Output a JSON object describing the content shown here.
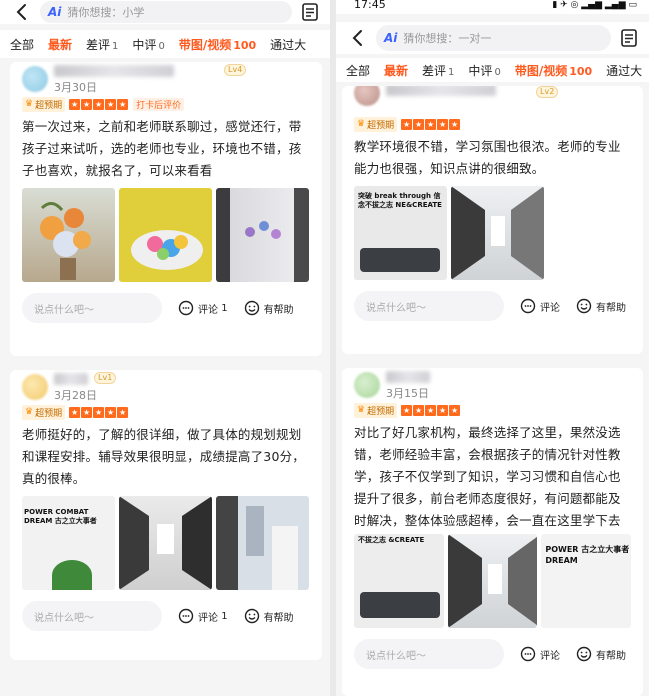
{
  "left": {
    "search_placeholder": "猜你想搜：小学",
    "ai_label": "Ai",
    "tabs": [
      {
        "label": "全部",
        "count": ""
      },
      {
        "label": "最新",
        "count": ""
      },
      {
        "label": "差评",
        "count": "1"
      },
      {
        "label": "中评",
        "count": "0"
      },
      {
        "label": "带图/视频",
        "count": "100"
      },
      {
        "label": "通过大",
        "count": ""
      }
    ],
    "reviews": [
      {
        "level": "Lv4",
        "date": "3月30日",
        "badge": "超预期",
        "clock_tag": "打卡后评价",
        "text": "第一次过来，之前和老师联系聊过，感觉还行，带孩子过来试听，选的老师也专业，环境也不错，孩子也喜欢，就报名了，可以来看看",
        "comment_placeholder": "说点什么吧～",
        "comment_label": "评论",
        "comment_count": "1",
        "helpful_label": "有帮助"
      },
      {
        "level": "Lv1",
        "date": "3月28日",
        "badge": "超预期",
        "text": "老师挺好的，了解的很详细，做了具体的规划规划和课程安排。辅导效果很明显，成绩提高了30分，真的很棒。",
        "wall_text": "POWER COMBAT DREAM 古之立大事者",
        "comment_placeholder": "说点什么吧～",
        "comment_label": "评论",
        "comment_count": "1",
        "helpful_label": "有帮助"
      }
    ]
  },
  "right": {
    "status_time": "17:45",
    "search_placeholder": "猜你想搜：一对一",
    "ai_label": "Ai",
    "tabs": [
      {
        "label": "全部",
        "count": ""
      },
      {
        "label": "最新",
        "count": ""
      },
      {
        "label": "差评",
        "count": "1"
      },
      {
        "label": "中评",
        "count": "0"
      },
      {
        "label": "带图/视频",
        "count": "100"
      },
      {
        "label": "通过大",
        "count": ""
      }
    ],
    "reviews": [
      {
        "level": "Lv2",
        "badge": "超预期",
        "text": "教学环境很不错，学习氛围也很浓。老师的专业能力也很强，知识点讲的很细致。",
        "wall_text": "突破 break through 信念不拔之志 NE&CREATE",
        "comment_placeholder": "说点什么吧～",
        "comment_label": "评论",
        "helpful_label": "有帮助"
      },
      {
        "date": "3月15日",
        "badge": "超预期",
        "text": "对比了好几家机构，最终选择了这里，果然没选错，老师经验丰富，会根据孩子的情况针对性教学，孩子不仅学到了知识，学习习惯和自信心也提升了很多，前台老师态度很好，有问题都能及时解决，整体体验感超棒，会一直在这里学下去",
        "wall_text": "不拔之志 &CREATE",
        "wall_text2": "POWER 古之立大事者 DREAM",
        "comment_placeholder": "说点什么吧～",
        "comment_label": "评论",
        "helpful_label": "有帮助"
      }
    ]
  },
  "colors": {
    "accent": "#ff5a1f",
    "star": "#ff6a1c",
    "ai_blue": "#3b64ff"
  }
}
